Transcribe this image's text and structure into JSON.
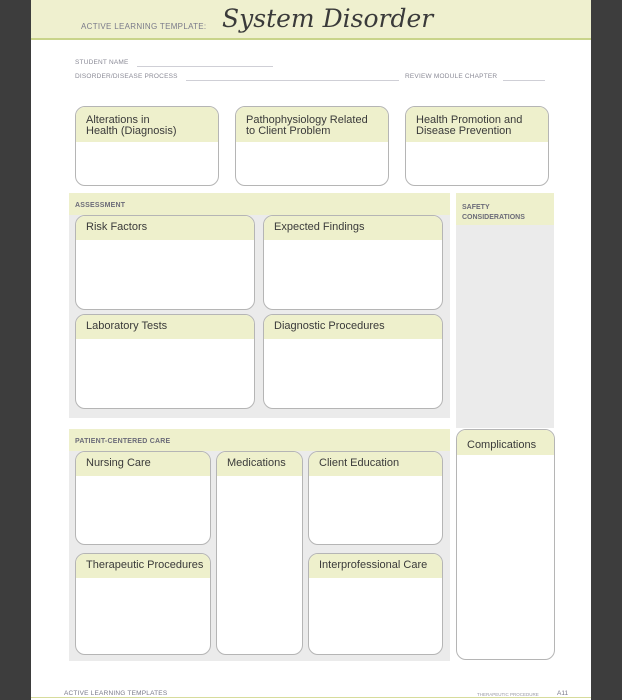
{
  "header": {
    "prefix": "Active Learning Template:",
    "title": "System Disorder"
  },
  "fields": {
    "student_name_label": "Student Name",
    "student_name_value": "",
    "disorder_label": "Disorder/Disease Process",
    "disorder_value": "",
    "review_module_label": "Review Module Chapter",
    "review_module_value": ""
  },
  "top_cards": [
    {
      "title": "Alterations in Health (Diagnosis)",
      "line1": "Alterations in",
      "line2": "Health (Diagnosis)",
      "content": ""
    },
    {
      "title": "Pathophysiology Related to Client Problem",
      "line1": "Pathophysiology Related",
      "line2": "to Client Problem",
      "content": ""
    },
    {
      "title": "Health Promotion and Disease Prevention",
      "line1": "Health Promotion and",
      "line2": "Disease Prevention",
      "content": ""
    }
  ],
  "assessment": {
    "title": "Assessment",
    "cards": [
      {
        "title": "Risk Factors",
        "content": ""
      },
      {
        "title": "Expected Findings",
        "content": ""
      },
      {
        "title": "Laboratory Tests",
        "content": ""
      },
      {
        "title": "Diagnostic Procedures",
        "content": ""
      }
    ]
  },
  "safety": {
    "title": "Safety Considerations",
    "content": ""
  },
  "patient_care": {
    "title": "Patient-Centered Care",
    "cards": [
      {
        "title": "Nursing Care",
        "content": ""
      },
      {
        "title": "Medications",
        "content": ""
      },
      {
        "title": "Client Education",
        "content": ""
      },
      {
        "title": "Therapeutic Procedures",
        "content": ""
      },
      {
        "title": "Interprofessional Care",
        "content": ""
      }
    ]
  },
  "complications": {
    "title": "Complications",
    "content": ""
  },
  "footer": {
    "left": "Active Learning Templates",
    "right": "Therapeutic Procedure",
    "page": "A11"
  }
}
